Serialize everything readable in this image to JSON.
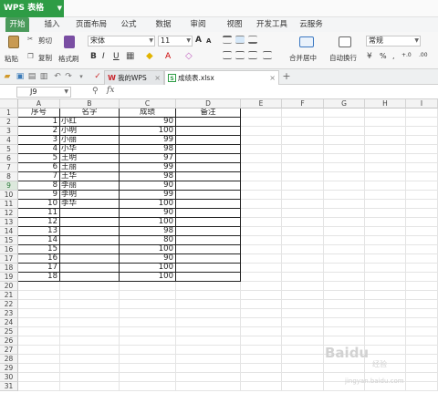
{
  "app": {
    "title": "WPS 表格",
    "accent": "#2e9c45"
  },
  "menu": [
    "开始",
    "插入",
    "页面布局",
    "公式",
    "数据",
    "审阅",
    "视图",
    "开发工具",
    "云服务"
  ],
  "ribbon": {
    "paste": "粘贴",
    "cut": "剪切",
    "copy": "复制",
    "format_painter": "格式刷",
    "font_name": "宋体",
    "font_size": "11",
    "bold": "B",
    "italic": "I",
    "underline": "U",
    "font_grow": "A",
    "font_shrink": "A",
    "merge_center": "合并居中",
    "wrap_text": "自动换行",
    "number_format": "常规",
    "percent": "%",
    "thousands": ",",
    "inc_decimal": "+.0",
    "dec_decimal": ".00"
  },
  "tabs": [
    {
      "label": "我的WPS",
      "icon": "wps-logo-icon"
    },
    {
      "label": "成绩表.xlsx",
      "icon": "spreadsheet-icon"
    }
  ],
  "formula_bar": {
    "cell_ref": "J9",
    "fx": "fx",
    "value": ""
  },
  "columns": [
    "A",
    "B",
    "C",
    "D",
    "E",
    "F",
    "G",
    "H",
    "I"
  ],
  "rows": [
    "1",
    "2",
    "3",
    "4",
    "5",
    "6",
    "7",
    "8",
    "9",
    "10",
    "11",
    "12",
    "13",
    "14",
    "15",
    "16",
    "17",
    "18",
    "19",
    "20",
    "21",
    "22",
    "23",
    "24",
    "25",
    "26",
    "27",
    "28",
    "29",
    "30",
    "31"
  ],
  "headers": {
    "a": "序号",
    "b": "名字",
    "c": "成绩",
    "d": "备注"
  },
  "table": [
    {
      "id": "1",
      "name": "小红",
      "score": "90",
      "note": ""
    },
    {
      "id": "2",
      "name": "小明",
      "score": "100",
      "note": ""
    },
    {
      "id": "3",
      "name": "小丽",
      "score": "99",
      "note": ""
    },
    {
      "id": "4",
      "name": "小华",
      "score": "98",
      "note": ""
    },
    {
      "id": "5",
      "name": "王明",
      "score": "97",
      "note": ""
    },
    {
      "id": "6",
      "name": "王丽",
      "score": "99",
      "note": ""
    },
    {
      "id": "7",
      "name": "王华",
      "score": "98",
      "note": ""
    },
    {
      "id": "8",
      "name": "李丽",
      "score": "90",
      "note": ""
    },
    {
      "id": "9",
      "name": "李明",
      "score": "99",
      "note": ""
    },
    {
      "id": "10",
      "name": "李华",
      "score": "100",
      "note": ""
    },
    {
      "id": "11",
      "name": "",
      "score": "90",
      "note": ""
    },
    {
      "id": "12",
      "name": "",
      "score": "100",
      "note": ""
    },
    {
      "id": "13",
      "name": "",
      "score": "98",
      "note": ""
    },
    {
      "id": "14",
      "name": "",
      "score": "80",
      "note": ""
    },
    {
      "id": "15",
      "name": "",
      "score": "100",
      "note": ""
    },
    {
      "id": "16",
      "name": "",
      "score": "90",
      "note": ""
    },
    {
      "id": "17",
      "name": "",
      "score": "100",
      "note": ""
    },
    {
      "id": "18",
      "name": "",
      "score": "100",
      "note": ""
    }
  ],
  "selected_row": "9",
  "watermark": {
    "brand": "Baidu",
    "sub": "经验",
    "url": "jingyan.baidu.com"
  }
}
